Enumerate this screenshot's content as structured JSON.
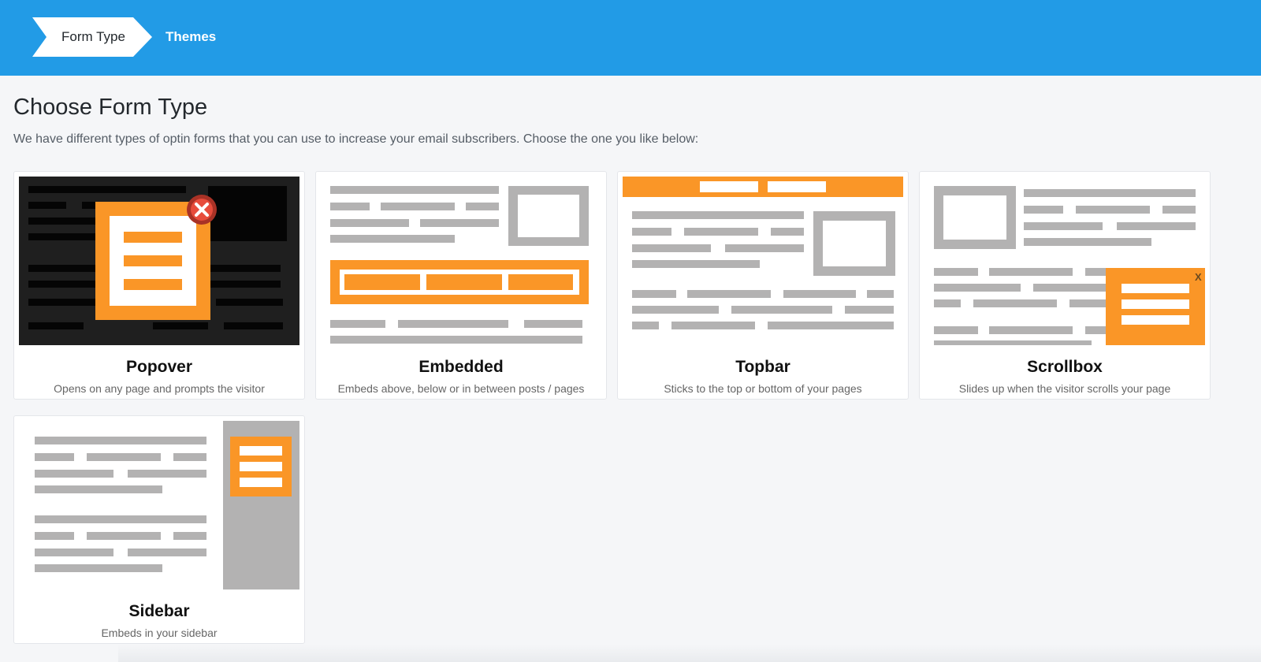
{
  "breadcrumb": {
    "active_label": "Form Type",
    "next_label": "Themes"
  },
  "page": {
    "title": "Choose Form Type",
    "description": "We have different types of optin forms that you can use to increase your email subscribers. Choose the one you like below:"
  },
  "form_types": [
    {
      "title": "Popover",
      "description": "Opens on any page and prompts the visitor"
    },
    {
      "title": "Embedded",
      "description": "Embeds above, below or in between posts / pages"
    },
    {
      "title": "Topbar",
      "description": "Sticks to the top or bottom of your pages"
    },
    {
      "title": "Scrollbox",
      "description": "Slides up when the visitor scrolls your page",
      "close_glyph": "X"
    },
    {
      "title": "Sidebar",
      "description": "Embeds in your sidebar"
    }
  ],
  "colors": {
    "header_blue": "#229be6",
    "accent_orange": "#fa9627",
    "placeholder_gray": "#b3b2b2",
    "popover_dark": "#1f1f1f",
    "close_red": "#c0392b"
  }
}
